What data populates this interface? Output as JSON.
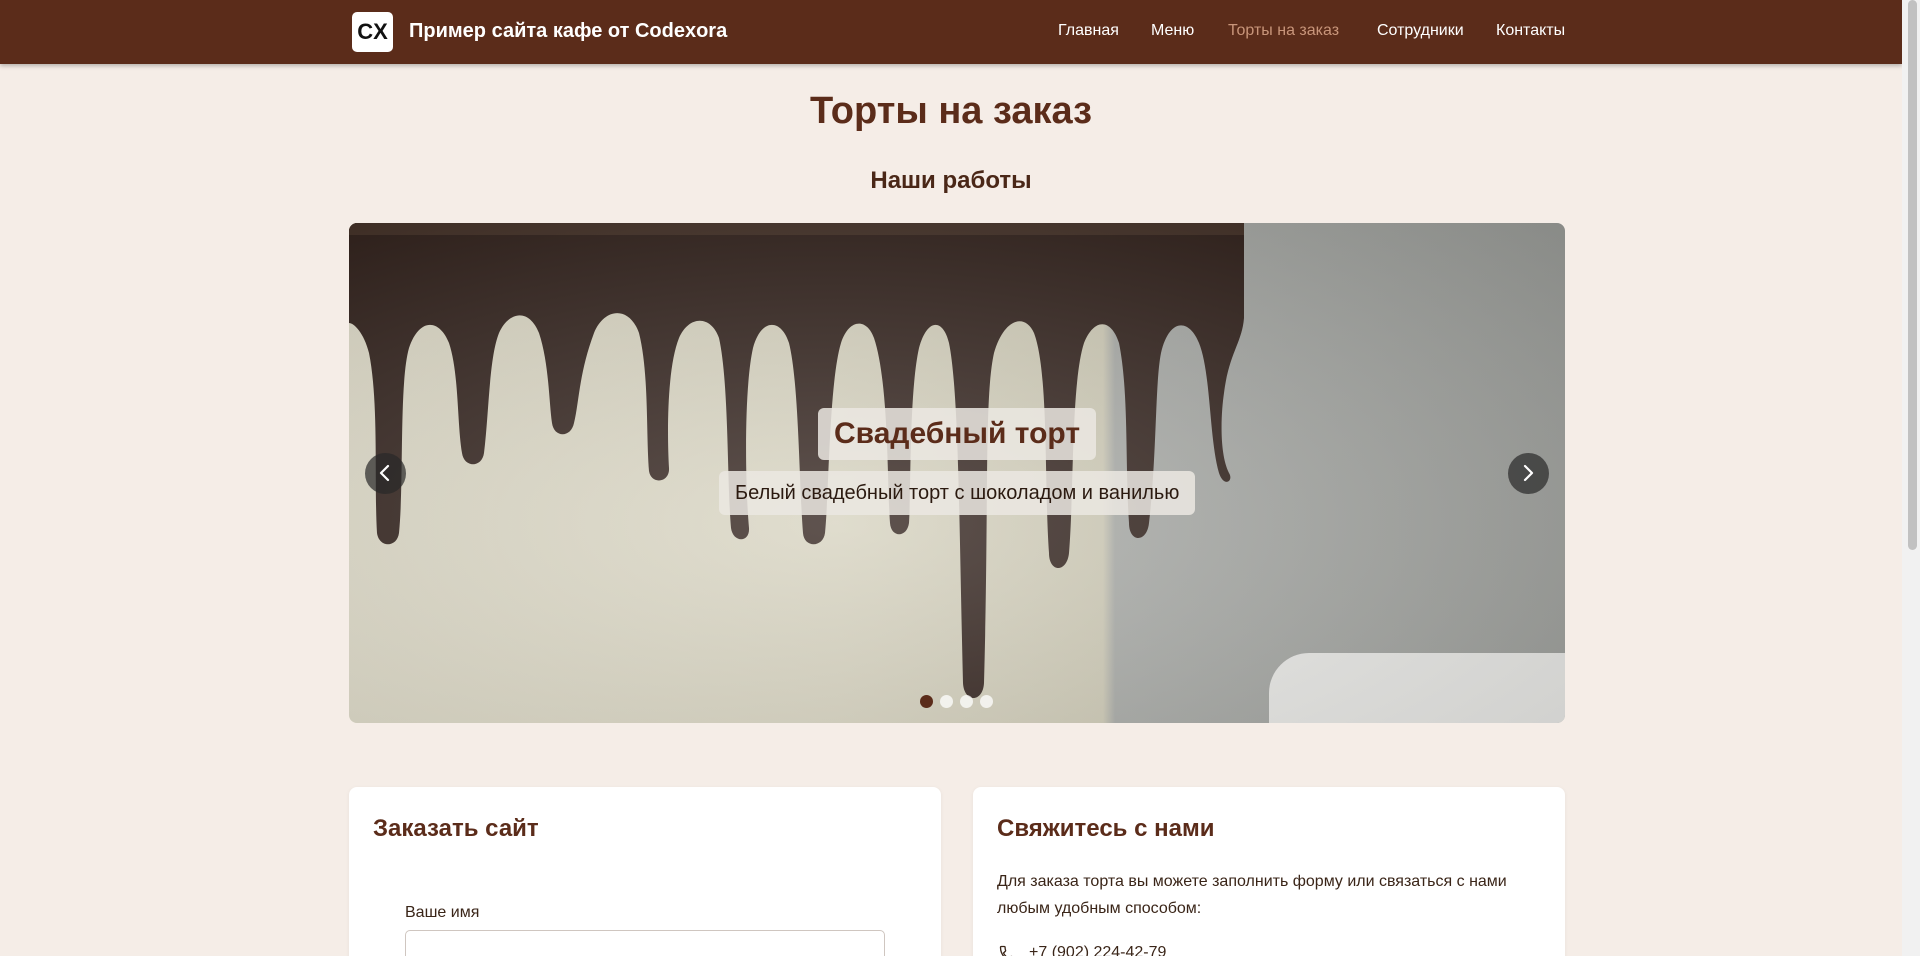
{
  "header": {
    "logo_text": "CX",
    "site_title": "Пример сайта кафе от Codexora",
    "nav": [
      {
        "label": "Главная",
        "active": false
      },
      {
        "label": "Меню",
        "active": false
      },
      {
        "label": "Торты на заказ",
        "active": true
      },
      {
        "label": "Сотрудники",
        "active": false
      },
      {
        "label": "Контакты",
        "active": false
      }
    ]
  },
  "page": {
    "title": "Торты на заказ",
    "section_title": "Наши работы"
  },
  "carousel": {
    "slide_title": "Свадебный торт",
    "slide_description": "Белый свадебный торт с шоколадом и ванилью",
    "slide_count": 4,
    "active_index": 0,
    "prev_icon": "chevron-left-icon",
    "next_icon": "chevron-right-icon"
  },
  "order_card": {
    "title": "Заказать сайт",
    "name_label": "Ваше имя",
    "name_value": ""
  },
  "contact_card": {
    "title": "Свяжитесь с нами",
    "text": "Для заказа торта вы можете заполнить форму или связаться с нами любым удобным способом:",
    "phone": "+7 (902) 224-42-79",
    "phone_icon": "phone-icon"
  },
  "colors": {
    "header_bg": "#5b2c1a",
    "page_bg": "#f5ede7",
    "accent": "#5b2c1a",
    "nav_active": "#c8957a"
  }
}
